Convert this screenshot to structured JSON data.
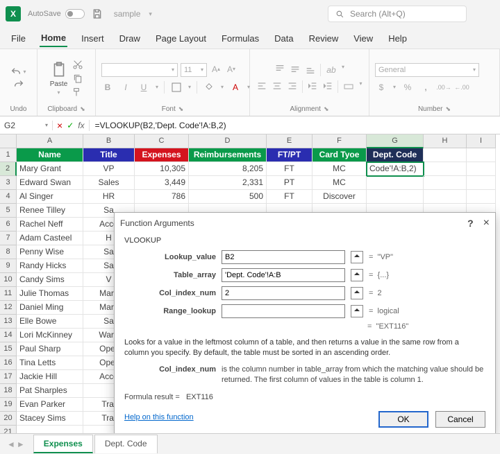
{
  "titleBar": {
    "autosave": "AutoSave",
    "docName": "sample",
    "searchPlaceholder": "Search (Alt+Q)"
  },
  "menu": [
    "File",
    "Home",
    "Insert",
    "Draw",
    "Page Layout",
    "Formulas",
    "Data",
    "Review",
    "View",
    "Help"
  ],
  "menuActive": "Home",
  "ribbon": {
    "undo": "Undo",
    "clipboard": "Clipboard",
    "paste": "Paste",
    "font": "Font",
    "fontSize": "11",
    "alignment": "Alignment",
    "number": "Number",
    "numberFormat": "General",
    "bold": "B",
    "italic": "I",
    "underline": "U"
  },
  "nameBox": "G2",
  "formula": "=VLOOKUP(B2,'Dept. Code'!A:B,2)",
  "columns": [
    "A",
    "B",
    "C",
    "D",
    "E",
    "F",
    "G",
    "H",
    "I"
  ],
  "selectedCol": "G",
  "selectedRow": 2,
  "headerRow": {
    "A": "Name",
    "B": "Title",
    "C": "Expenses",
    "D": "Reimbursements",
    "E": "FT/PT",
    "F": "Card Tyoe",
    "G": "Dept. Code"
  },
  "headerColors": {
    "A": "#0a9a4a",
    "B": "#2a2db0",
    "C": "#d4141e",
    "D": "#0a9a4a",
    "E": "#2a2db0",
    "F": "#0a9a4a",
    "G": "#1f2f58"
  },
  "g2_display": "Code'!A:B,2)",
  "rows": [
    {
      "n": 2,
      "A": "Mary Grant",
      "B": "VP",
      "C": "10,305",
      "D": "8,205",
      "E": "FT",
      "F": "MC"
    },
    {
      "n": 3,
      "A": "Edward Swan",
      "B": "Sales",
      "C": "3,449",
      "D": "2,331",
      "E": "PT",
      "F": "MC"
    },
    {
      "n": 4,
      "A": "Al Singer",
      "B": "HR",
      "C": "786",
      "D": "500",
      "E": "FT",
      "F": "Discover"
    },
    {
      "n": 5,
      "A": "Renee Tilley",
      "B": "Sa"
    },
    {
      "n": 6,
      "A": "Rachel Neff",
      "B": "Acco"
    },
    {
      "n": 7,
      "A": "Adam Casteel",
      "B": "H"
    },
    {
      "n": 8,
      "A": "Penny Wise",
      "B": "Sa"
    },
    {
      "n": 9,
      "A": "Randy Hicks",
      "B": "Sa"
    },
    {
      "n": 10,
      "A": "Candy Sims",
      "B": "V"
    },
    {
      "n": 11,
      "A": "Julie Thomas",
      "B": "Mark"
    },
    {
      "n": 12,
      "A": "Daniel Ming",
      "B": "Mark"
    },
    {
      "n": 13,
      "A": "Elle Bowe",
      "B": "Sa"
    },
    {
      "n": 14,
      "A": "Lori McKinney",
      "B": "Ware"
    },
    {
      "n": 15,
      "A": "Paul Sharp",
      "B": "Oper"
    },
    {
      "n": 16,
      "A": "Tina Letts",
      "B": "Oper"
    },
    {
      "n": 17,
      "A": "Jackie Hill",
      "B": "Acco"
    },
    {
      "n": 18,
      "A": "Pat Sharples",
      "B": ""
    },
    {
      "n": 19,
      "A": "Evan Parker",
      "B": "Trai"
    },
    {
      "n": 20,
      "A": "Stacey Sims",
      "B": "Trai"
    },
    {
      "n": 21,
      "A": "",
      "B": ""
    }
  ],
  "dialog": {
    "title": "Function Arguments",
    "func": "VLOOKUP",
    "args": [
      {
        "name": "Lookup_value",
        "value": "B2",
        "result": "\"VP\""
      },
      {
        "name": "Table_array",
        "value": "'Dept. Code'!A:B",
        "result": "{...}"
      },
      {
        "name": "Col_index_num",
        "value": "2",
        "result": "2"
      },
      {
        "name": "Range_lookup",
        "value": "",
        "result": "logical"
      }
    ],
    "overallResult": "\"EXT116\"",
    "desc1": "Looks for a value in the leftmost column of a table, and then returns a value in the same row from a column you specify. By default, the table must be sorted in an ascending order.",
    "desc2_label": "Col_index_num",
    "desc2_text": "is the column number in table_array from which the matching value should be returned. The first column of values in the table is column 1.",
    "formulaResultLabel": "Formula result =",
    "formulaResult": "EXT116",
    "helpLink": "Help on this function",
    "ok": "OK",
    "cancel": "Cancel"
  },
  "sheets": [
    "Expenses",
    "Dept. Code"
  ],
  "activeSheet": "Expenses"
}
